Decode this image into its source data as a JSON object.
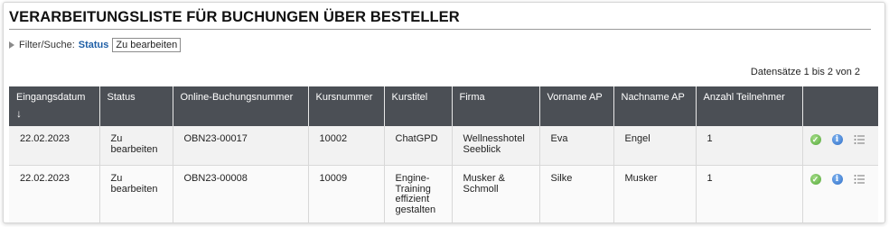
{
  "page": {
    "title": "VERARBEITUNGSLISTE FÜR BUCHUNGEN ÜBER BESTELLER"
  },
  "filter": {
    "label": "Filter/Suche:",
    "field": "Status",
    "value": "Zu bearbeiten"
  },
  "records": {
    "count_text": "Datensätze 1 bis 2 von 2"
  },
  "table": {
    "headers": {
      "eingangsdatum": "Eingangsdatum",
      "sort_indicator": "↓",
      "status": "Status",
      "online_buchungsnummer": "Online-Buchungsnummer",
      "kursnummer": "Kursnummer",
      "kurstitel": "Kurstitel",
      "firma": "Firma",
      "vorname_ap": "Vorname AP",
      "nachname_ap": "Nachname AP",
      "anzahl_teilnehmer": "Anzahl Teilnehmer"
    },
    "rows": [
      {
        "eingangsdatum": "22.02.2023",
        "status": "Zu bearbeiten",
        "online_buchungsnummer": "OBN23-00017",
        "kursnummer": "10002",
        "kurstitel": "ChatGPD",
        "firma": "Wellnesshotel Seeblick",
        "vorname_ap": "Eva",
        "nachname_ap": "Engel",
        "anzahl_teilnehmer": "1",
        "actions": [
          "check-icon",
          "info-icon",
          "list-icon"
        ]
      },
      {
        "eingangsdatum": "22.02.2023",
        "status": "Zu bearbeiten",
        "online_buchungsnummer": "OBN23-00008",
        "kursnummer": "10009",
        "kurstitel": "Engine-Training effizient gestalten",
        "firma": "Musker & Schmoll",
        "vorname_ap": "Silke",
        "nachname_ap": "Musker",
        "anzahl_teilnehmer": "1",
        "actions": [
          "check-icon",
          "info-icon",
          "list-icon"
        ]
      }
    ]
  },
  "colors": {
    "header_bg": "#4b4f55",
    "link_blue": "#1f5fa6",
    "row_alt_1": "#f2f2f2",
    "row_alt_2": "#fafafa",
    "check_green": "#55a83a",
    "info_blue": "#2f6fc7"
  }
}
